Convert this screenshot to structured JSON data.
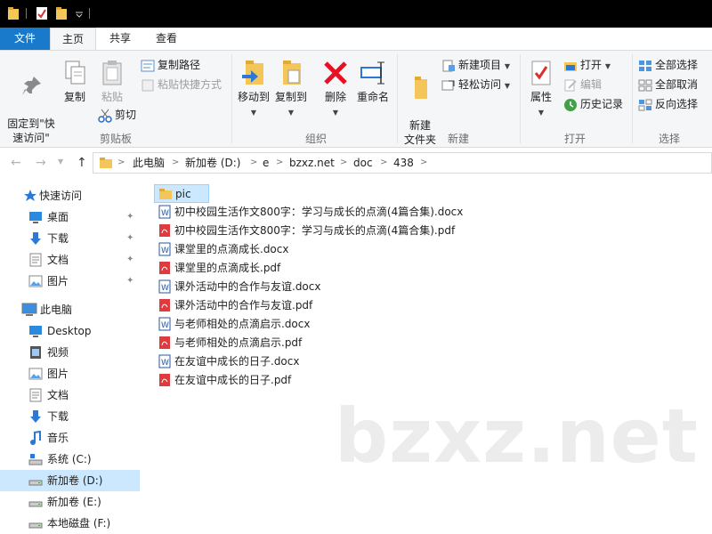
{
  "tabs": {
    "file": "文件",
    "home": "主页",
    "share": "共享",
    "view": "查看"
  },
  "ribbon": {
    "clipboard": {
      "pin_quick_access": "固定到\"快\n速访问\"",
      "copy": "复制",
      "paste": "粘贴",
      "copy_path": "复制路径",
      "paste_shortcut": "粘贴快捷方式",
      "cut": "剪切",
      "group_label": "剪贴板"
    },
    "organize": {
      "move_to": "移动到",
      "copy_to": "复制到",
      "delete": "删除",
      "rename": "重命名",
      "group_label": "组织"
    },
    "new": {
      "new_folder": "新建\n文件夹",
      "new_item": "新建项目",
      "easy_access": "轻松访问",
      "group_label": "新建"
    },
    "open": {
      "properties": "属性",
      "open": "打开",
      "edit": "编辑",
      "history": "历史记录",
      "group_label": "打开"
    },
    "select": {
      "select_all": "全部选择",
      "select_none": "全部取消",
      "invert": "反向选择",
      "group_label": "选择"
    }
  },
  "address": {
    "crumbs": [
      "此电脑",
      "新加卷 (D:)",
      "e",
      "bzxz.net",
      "doc",
      "438"
    ]
  },
  "nav": {
    "quick_access": "快速访问",
    "quick_items": [
      "桌面",
      "下载",
      "文档",
      "图片"
    ],
    "this_pc": "此电脑",
    "pc_items": [
      "Desktop",
      "视频",
      "图片",
      "文档",
      "下载",
      "音乐",
      "系统 (C:)",
      "新加卷 (D:)",
      "新加卷 (E:)",
      "本地磁盘 (F:)"
    ]
  },
  "files": [
    {
      "name": "pic",
      "type": "folder"
    },
    {
      "name": "初中校园生活作文800字：学习与成长的点滴(4篇合集).docx",
      "type": "docx"
    },
    {
      "name": "初中校园生活作文800字：学习与成长的点滴(4篇合集).pdf",
      "type": "pdf"
    },
    {
      "name": "课堂里的点滴成长.docx",
      "type": "docx"
    },
    {
      "name": "课堂里的点滴成长.pdf",
      "type": "pdf"
    },
    {
      "name": "课外活动中的合作与友谊.docx",
      "type": "docx"
    },
    {
      "name": "课外活动中的合作与友谊.pdf",
      "type": "pdf"
    },
    {
      "name": "与老师相处的点滴启示.docx",
      "type": "docx"
    },
    {
      "name": "与老师相处的点滴启示.pdf",
      "type": "pdf"
    },
    {
      "name": "在友谊中成长的日子.docx",
      "type": "docx"
    },
    {
      "name": "在友谊中成长的日子.pdf",
      "type": "pdf"
    }
  ],
  "watermark": "bzxz.net",
  "colors": {
    "accent": "#1979ca",
    "selection": "#cce8ff",
    "folder": "#f4c65a",
    "pdf": "#e03a3e",
    "docx": "#2b579a",
    "delete": "#e81123"
  }
}
